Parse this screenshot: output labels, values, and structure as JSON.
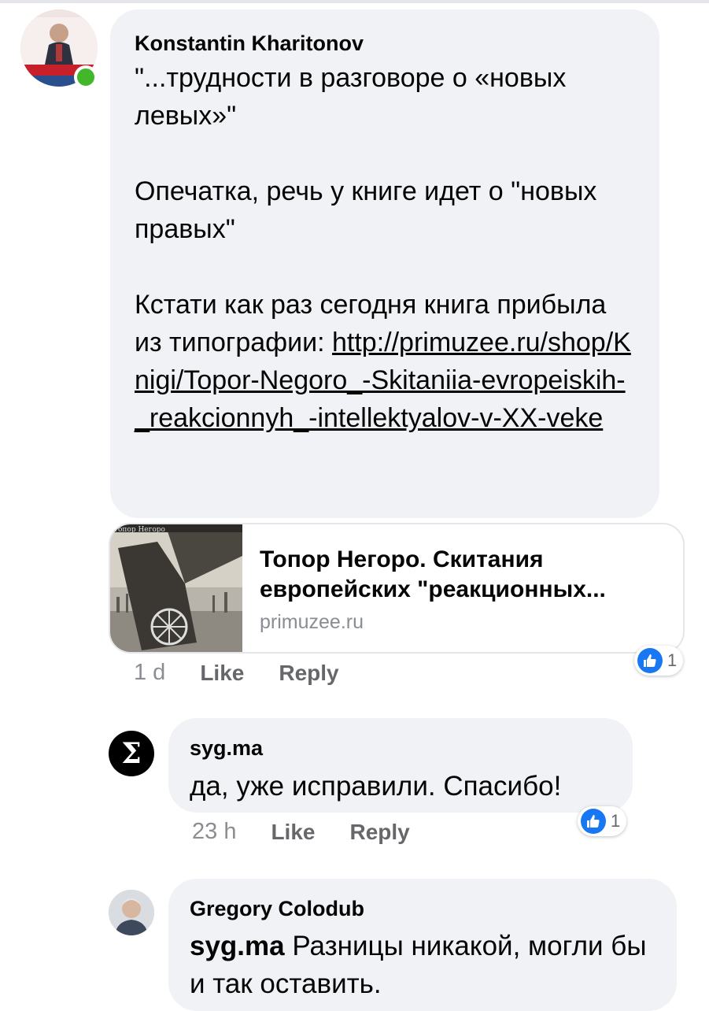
{
  "colors": {
    "bubble": "#f0f2f5",
    "like_blue": "#1877f2",
    "online": "#42b72a",
    "meta_text": "#65676b"
  },
  "comments": [
    {
      "author": "Konstantin Kharitonov",
      "avatar_icon": "profile-photo",
      "online": true,
      "text_lines": "\"...трудности в разговоре о «новых левых»\"\n\nОпечатка, речь у книге идет о \"новых правых\"\n\nКстати как раз сегодня книга прибыла из типографии: ",
      "link": "http://primuzee.ru/shop/Knigi/Topor-Negoro_-Skitaniia-evropeiskih-_reakcionnyh_-intellektyalov-v-XX-veke",
      "preview": {
        "thumb_caption": "Топор Негоро",
        "title": "Топор Негоро. Скитания европейских \"реакционных...",
        "domain": "primuzee.ru"
      },
      "time": "1 d",
      "like_label": "Like",
      "reply_label": "Reply",
      "reaction_count": "1"
    },
    {
      "author": "syg.ma",
      "avatar_icon": "sigma-logo-icon",
      "text": "да, уже исправили. Спасибо!",
      "time": "23 h",
      "like_label": "Like",
      "reply_label": "Reply",
      "reaction_count": "1"
    },
    {
      "author": "Gregory Colodub",
      "avatar_icon": "profile-photo",
      "mention": "syg.ma",
      "text": " Разницы никакой, могли бы и так оставить."
    }
  ]
}
